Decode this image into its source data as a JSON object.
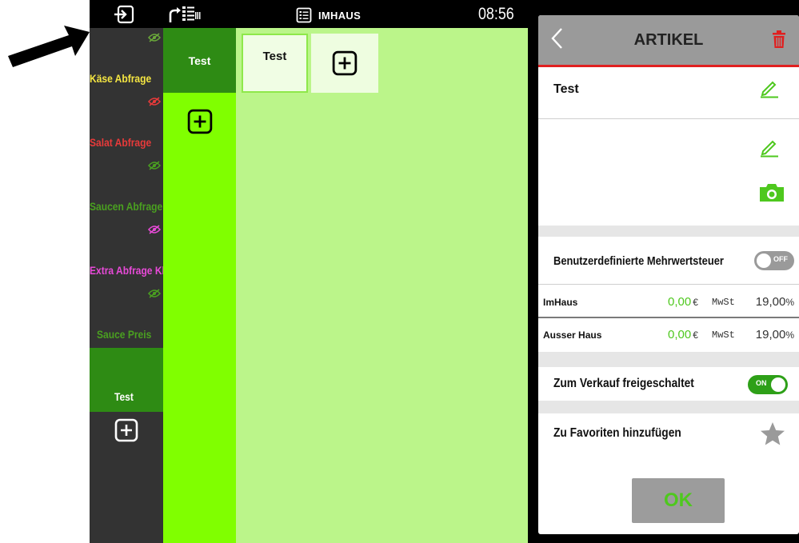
{
  "status_bar": {
    "mode_label": "IMHAUS",
    "time": "08:56"
  },
  "categories": [
    {
      "label": "Käse Abfrage",
      "color": "#f5e642",
      "eye_color": "#6aa83a"
    },
    {
      "label": "Salat Abfrage",
      "color": "#e83a3a",
      "eye_color": "#e83a3a"
    },
    {
      "label": "Saucen Abfrage",
      "color": "#4aa020",
      "eye_color": "#4aa020"
    },
    {
      "label": "Extra Abfrage Kl",
      "color": "#e84ad8",
      "eye_color": "#e84ad8"
    },
    {
      "label": "Sauce Preis",
      "color": "#4aa020",
      "eye_color": "#4aa020"
    },
    {
      "label": "Test",
      "color": "#ffffff",
      "active": true
    }
  ],
  "subgroups": [
    {
      "label": "Test"
    }
  ],
  "articles": [
    {
      "label": "Test"
    }
  ],
  "panel": {
    "title": "ARTIKEL",
    "name_value": "Test",
    "custom_vat_label": "Benutzerdefinierte Mehrwertsteuer",
    "custom_vat_toggle": "OFF",
    "prices": [
      {
        "label": "ImHaus",
        "price": "0,00",
        "currency": "€",
        "vat_label": "MwSt",
        "vat": "19,00",
        "vat_unit": "%"
      },
      {
        "label": "Ausser Haus",
        "price": "0,00",
        "currency": "€",
        "vat_label": "MwSt",
        "vat": "19,00",
        "vat_unit": "%"
      }
    ],
    "sale_label": "Zum Verkauf freigeschaltet",
    "sale_toggle": "ON",
    "favorites_label": "Zu Favoriten hinzufügen",
    "ok_label": "OK"
  },
  "colors": {
    "accent_green": "#4ec81e",
    "dark_green": "#2e8b14",
    "lime": "#80ff00",
    "pale_green": "#bbf58a",
    "header_grey": "#9a9a9a",
    "danger_red": "#e02020"
  }
}
